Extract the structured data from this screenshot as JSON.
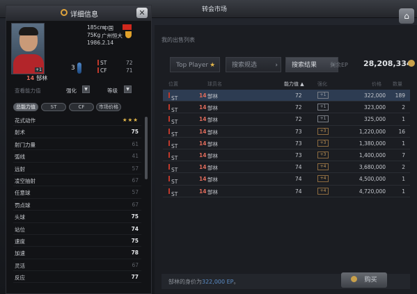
{
  "topbar": {
    "title": "转会市场",
    "right_icon": "home-icon"
  },
  "main": {
    "subtitle": "我的出售列表",
    "tabs": [
      {
        "label": "Top Player",
        "icon": "star-icon"
      },
      {
        "label": "搜索规选"
      },
      {
        "label": "搜索结果"
      }
    ],
    "ep_label": "剩余EP",
    "ep_value": "28,208,334",
    "columns": [
      "位置",
      "球员名",
      "能力值 ▲",
      "强化",
      "价格",
      "数量"
    ],
    "rows": [
      {
        "pos": "ST",
        "num": "14",
        "name": "郜林",
        "ability": "72",
        "level": "+1",
        "price": "322,000",
        "qty": "189"
      },
      {
        "pos": "ST",
        "num": "14",
        "name": "郜林",
        "ability": "72",
        "level": "+1",
        "price": "323,000",
        "qty": "2"
      },
      {
        "pos": "ST",
        "num": "14",
        "name": "郜林",
        "ability": "72",
        "level": "+1",
        "price": "325,000",
        "qty": "1"
      },
      {
        "pos": "ST",
        "num": "14",
        "name": "郜林",
        "ability": "73",
        "level": "+3",
        "price": "1,220,000",
        "qty": "16"
      },
      {
        "pos": "ST",
        "num": "14",
        "name": "郜林",
        "ability": "73",
        "level": "+3",
        "price": "1,380,000",
        "qty": "1"
      },
      {
        "pos": "ST",
        "num": "14",
        "name": "郜林",
        "ability": "73",
        "level": "+3",
        "price": "1,400,000",
        "qty": "7"
      },
      {
        "pos": "ST",
        "num": "14",
        "name": "郜林",
        "ability": "74",
        "level": "+4",
        "price": "3,680,000",
        "qty": "2"
      },
      {
        "pos": "ST",
        "num": "14",
        "name": "郜林",
        "ability": "74",
        "level": "+4",
        "price": "4,500,000",
        "qty": "1"
      },
      {
        "pos": "ST",
        "num": "14",
        "name": "郜林",
        "ability": "74",
        "level": "+4",
        "price": "4,720,000",
        "qty": "1"
      }
    ],
    "footer_prefix": "郜林的身价为",
    "footer_value": "322,000 EP",
    "footer_suffix": "。",
    "buy_label": "购买"
  },
  "panel": {
    "title": "详细信息",
    "height": "185cm",
    "weight": "75Kg",
    "birthday": "1986.2.14",
    "nation": "中国",
    "club": "广州恒大",
    "badge": "+1",
    "number": "14",
    "name": "郜林",
    "overall": "3",
    "positions": [
      {
        "pos": "ST",
        "val": "72"
      },
      {
        "pos": "CF",
        "val": "71"
      }
    ],
    "filter_label": "查看能力值",
    "enhance_label": "强化",
    "grade_label": "等级",
    "btabs": [
      "总能力值",
      "ST",
      "CF",
      "市场价格"
    ],
    "attributes": [
      {
        "name": "花式动作",
        "value": "★★★"
      },
      {
        "name": "射术",
        "value": "75"
      },
      {
        "name": "射门力量",
        "value": "61"
      },
      {
        "name": "弧线",
        "value": "41"
      },
      {
        "name": "远射",
        "value": "57"
      },
      {
        "name": "凌空抽射",
        "value": "67"
      },
      {
        "name": "任意球",
        "value": "57"
      },
      {
        "name": "罚点球",
        "value": "67"
      },
      {
        "name": "头球",
        "value": "75"
      },
      {
        "name": "站位",
        "value": "74"
      },
      {
        "name": "速度",
        "value": "75"
      },
      {
        "name": "加速",
        "value": "78"
      },
      {
        "name": "灵活",
        "value": "67"
      },
      {
        "name": "反应",
        "value": "77"
      }
    ]
  }
}
